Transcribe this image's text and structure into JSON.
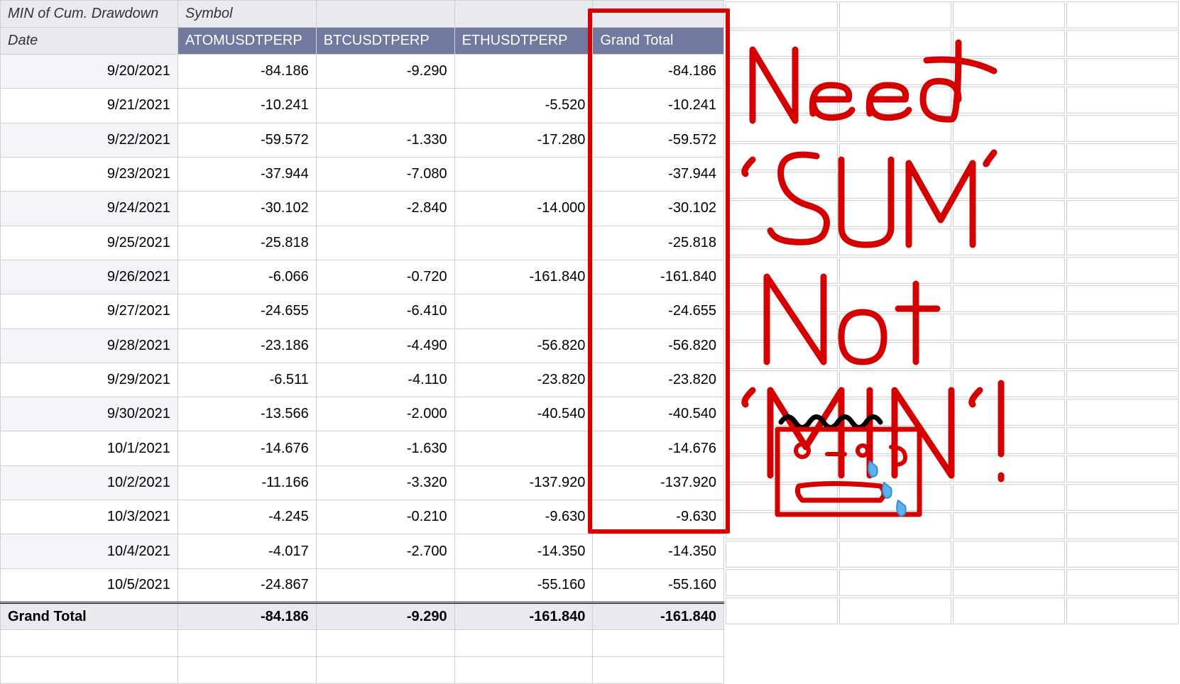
{
  "pivot": {
    "corner_label": "MIN of Cum. Drawdown",
    "col_group_label": "Symbol",
    "row_header_label": "Date",
    "columns": [
      "ATOMUSDTPERP",
      "BTCUSDTPERP",
      "ETHUSDTPERP",
      "Grand Total"
    ],
    "rows": [
      {
        "date": "9/20/2021",
        "values": [
          "-84.186",
          "-9.290",
          "",
          "-84.186"
        ]
      },
      {
        "date": "9/21/2021",
        "values": [
          "-10.241",
          "",
          "-5.520",
          "-10.241"
        ]
      },
      {
        "date": "9/22/2021",
        "values": [
          "-59.572",
          "-1.330",
          "-17.280",
          "-59.572"
        ]
      },
      {
        "date": "9/23/2021",
        "values": [
          "-37.944",
          "-7.080",
          "",
          "-37.944"
        ]
      },
      {
        "date": "9/24/2021",
        "values": [
          "-30.102",
          "-2.840",
          "-14.000",
          "-30.102"
        ]
      },
      {
        "date": "9/25/2021",
        "values": [
          "-25.818",
          "",
          "",
          "-25.818"
        ]
      },
      {
        "date": "9/26/2021",
        "values": [
          "-6.066",
          "-0.720",
          "-161.840",
          "-161.840"
        ]
      },
      {
        "date": "9/27/2021",
        "values": [
          "-24.655",
          "-6.410",
          "",
          "-24.655"
        ]
      },
      {
        "date": "9/28/2021",
        "values": [
          "-23.186",
          "-4.490",
          "-56.820",
          "-56.820"
        ]
      },
      {
        "date": "9/29/2021",
        "values": [
          "-6.511",
          "-4.110",
          "-23.820",
          "-23.820"
        ]
      },
      {
        "date": "9/30/2021",
        "values": [
          "-13.566",
          "-2.000",
          "-40.540",
          "-40.540"
        ]
      },
      {
        "date": "10/1/2021",
        "values": [
          "-14.676",
          "-1.630",
          "",
          "-14.676"
        ]
      },
      {
        "date": "10/2/2021",
        "values": [
          "-11.166",
          "-3.320",
          "-137.920",
          "-137.920"
        ]
      },
      {
        "date": "10/3/2021",
        "values": [
          "-4.245",
          "-0.210",
          "-9.630",
          "-9.630"
        ]
      },
      {
        "date": "10/4/2021",
        "values": [
          "-4.017",
          "-2.700",
          "-14.350",
          "-14.350"
        ]
      },
      {
        "date": "10/5/2021",
        "values": [
          "-24.867",
          "",
          "-55.160",
          "-55.160"
        ]
      }
    ],
    "grand_total_label": "Grand Total",
    "grand_total_values": [
      "-84.186",
      "-9.290",
      "-161.840",
      "-161.840"
    ]
  },
  "annotation": {
    "text_lines": [
      "Need",
      "'SUM'",
      "Not",
      "'MIN'!"
    ]
  },
  "chart_data": {
    "type": "table",
    "title": "MIN of Cum. Drawdown",
    "row_dimension": "Date",
    "column_dimension": "Symbol",
    "columns": [
      "ATOMUSDTPERP",
      "BTCUSDTPERP",
      "ETHUSDTPERP",
      "Grand Total"
    ],
    "rows": [
      {
        "Date": "9/20/2021",
        "ATOMUSDTPERP": -84.186,
        "BTCUSDTPERP": -9.29,
        "ETHUSDTPERP": null,
        "Grand Total": -84.186
      },
      {
        "Date": "9/21/2021",
        "ATOMUSDTPERP": -10.241,
        "BTCUSDTPERP": null,
        "ETHUSDTPERP": -5.52,
        "Grand Total": -10.241
      },
      {
        "Date": "9/22/2021",
        "ATOMUSDTPERP": -59.572,
        "BTCUSDTPERP": -1.33,
        "ETHUSDTPERP": -17.28,
        "Grand Total": -59.572
      },
      {
        "Date": "9/23/2021",
        "ATOMUSDTPERP": -37.944,
        "BTCUSDTPERP": -7.08,
        "ETHUSDTPERP": null,
        "Grand Total": -37.944
      },
      {
        "Date": "9/24/2021",
        "ATOMUSDTPERP": -30.102,
        "BTCUSDTPERP": -2.84,
        "ETHUSDTPERP": -14.0,
        "Grand Total": -30.102
      },
      {
        "Date": "9/25/2021",
        "ATOMUSDTPERP": -25.818,
        "BTCUSDTPERP": null,
        "ETHUSDTPERP": null,
        "Grand Total": -25.818
      },
      {
        "Date": "9/26/2021",
        "ATOMUSDTPERP": -6.066,
        "BTCUSDTPERP": -0.72,
        "ETHUSDTPERP": -161.84,
        "Grand Total": -161.84
      },
      {
        "Date": "9/27/2021",
        "ATOMUSDTPERP": -24.655,
        "BTCUSDTPERP": -6.41,
        "ETHUSDTPERP": null,
        "Grand Total": -24.655
      },
      {
        "Date": "9/28/2021",
        "ATOMUSDTPERP": -23.186,
        "BTCUSDTPERP": -4.49,
        "ETHUSDTPERP": -56.82,
        "Grand Total": -56.82
      },
      {
        "Date": "9/29/2021",
        "ATOMUSDTPERP": -6.511,
        "BTCUSDTPERP": -4.11,
        "ETHUSDTPERP": -23.82,
        "Grand Total": -23.82
      },
      {
        "Date": "9/30/2021",
        "ATOMUSDTPERP": -13.566,
        "BTCUSDTPERP": -2.0,
        "ETHUSDTPERP": -40.54,
        "Grand Total": -40.54
      },
      {
        "Date": "10/1/2021",
        "ATOMUSDTPERP": -14.676,
        "BTCUSDTPERP": -1.63,
        "ETHUSDTPERP": null,
        "Grand Total": -14.676
      },
      {
        "Date": "10/2/2021",
        "ATOMUSDTPERP": -11.166,
        "BTCUSDTPERP": -3.32,
        "ETHUSDTPERP": -137.92,
        "Grand Total": -137.92
      },
      {
        "Date": "10/3/2021",
        "ATOMUSDTPERP": -4.245,
        "BTCUSDTPERP": -0.21,
        "ETHUSDTPERP": -9.63,
        "Grand Total": -9.63
      },
      {
        "Date": "10/4/2021",
        "ATOMUSDTPERP": -4.017,
        "BTCUSDTPERP": -2.7,
        "ETHUSDTPERP": -14.35,
        "Grand Total": -14.35
      },
      {
        "Date": "10/5/2021",
        "ATOMUSDTPERP": -24.867,
        "BTCUSDTPERP": null,
        "ETHUSDTPERP": -55.16,
        "Grand Total": -55.16
      }
    ],
    "grand_total_row": {
      "ATOMUSDTPERP": -84.186,
      "BTCUSDTPERP": -9.29,
      "ETHUSDTPERP": -161.84,
      "Grand Total": -161.84
    }
  }
}
